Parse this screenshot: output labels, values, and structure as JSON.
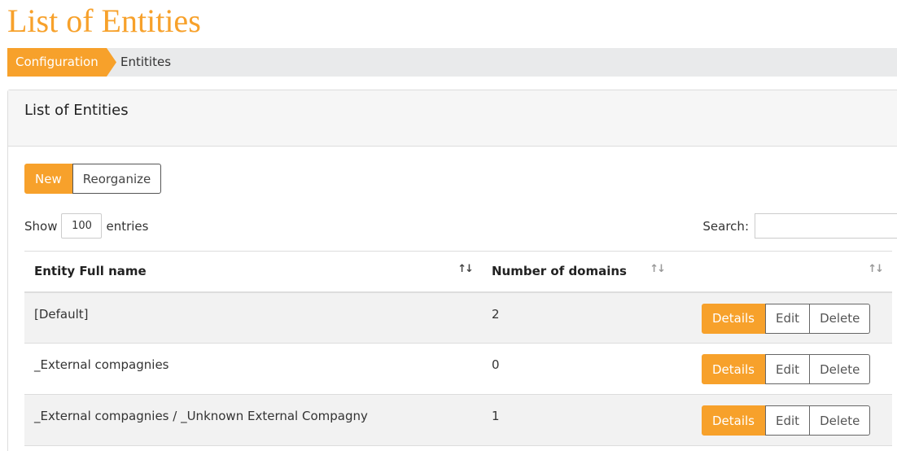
{
  "page": {
    "title": "List of Entities"
  },
  "breadcrumb": {
    "items": [
      "Configuration",
      "Entitites"
    ]
  },
  "panel": {
    "title": "List of Entities"
  },
  "toolbar": {
    "new_label": "New",
    "reorganize_label": "Reorganize"
  },
  "length": {
    "prefix": "Show",
    "value": "100",
    "suffix": "entries"
  },
  "search": {
    "label": "Search:",
    "value": ""
  },
  "table": {
    "columns": [
      "Entity Full name",
      "Number of domains",
      ""
    ],
    "actions": {
      "details": "Details",
      "edit": "Edit",
      "delete": "Delete"
    },
    "rows": [
      {
        "name": "[Default]",
        "domains": "2"
      },
      {
        "name": "_External compagnies",
        "domains": "0"
      },
      {
        "name": "_External compagnies / _Unknown External Compagny",
        "domains": "1"
      }
    ]
  },
  "colors": {
    "accent": "#f7a12b",
    "breadcrumb_bg": "#e9eaeb",
    "stripe": "#f2f2f2"
  }
}
